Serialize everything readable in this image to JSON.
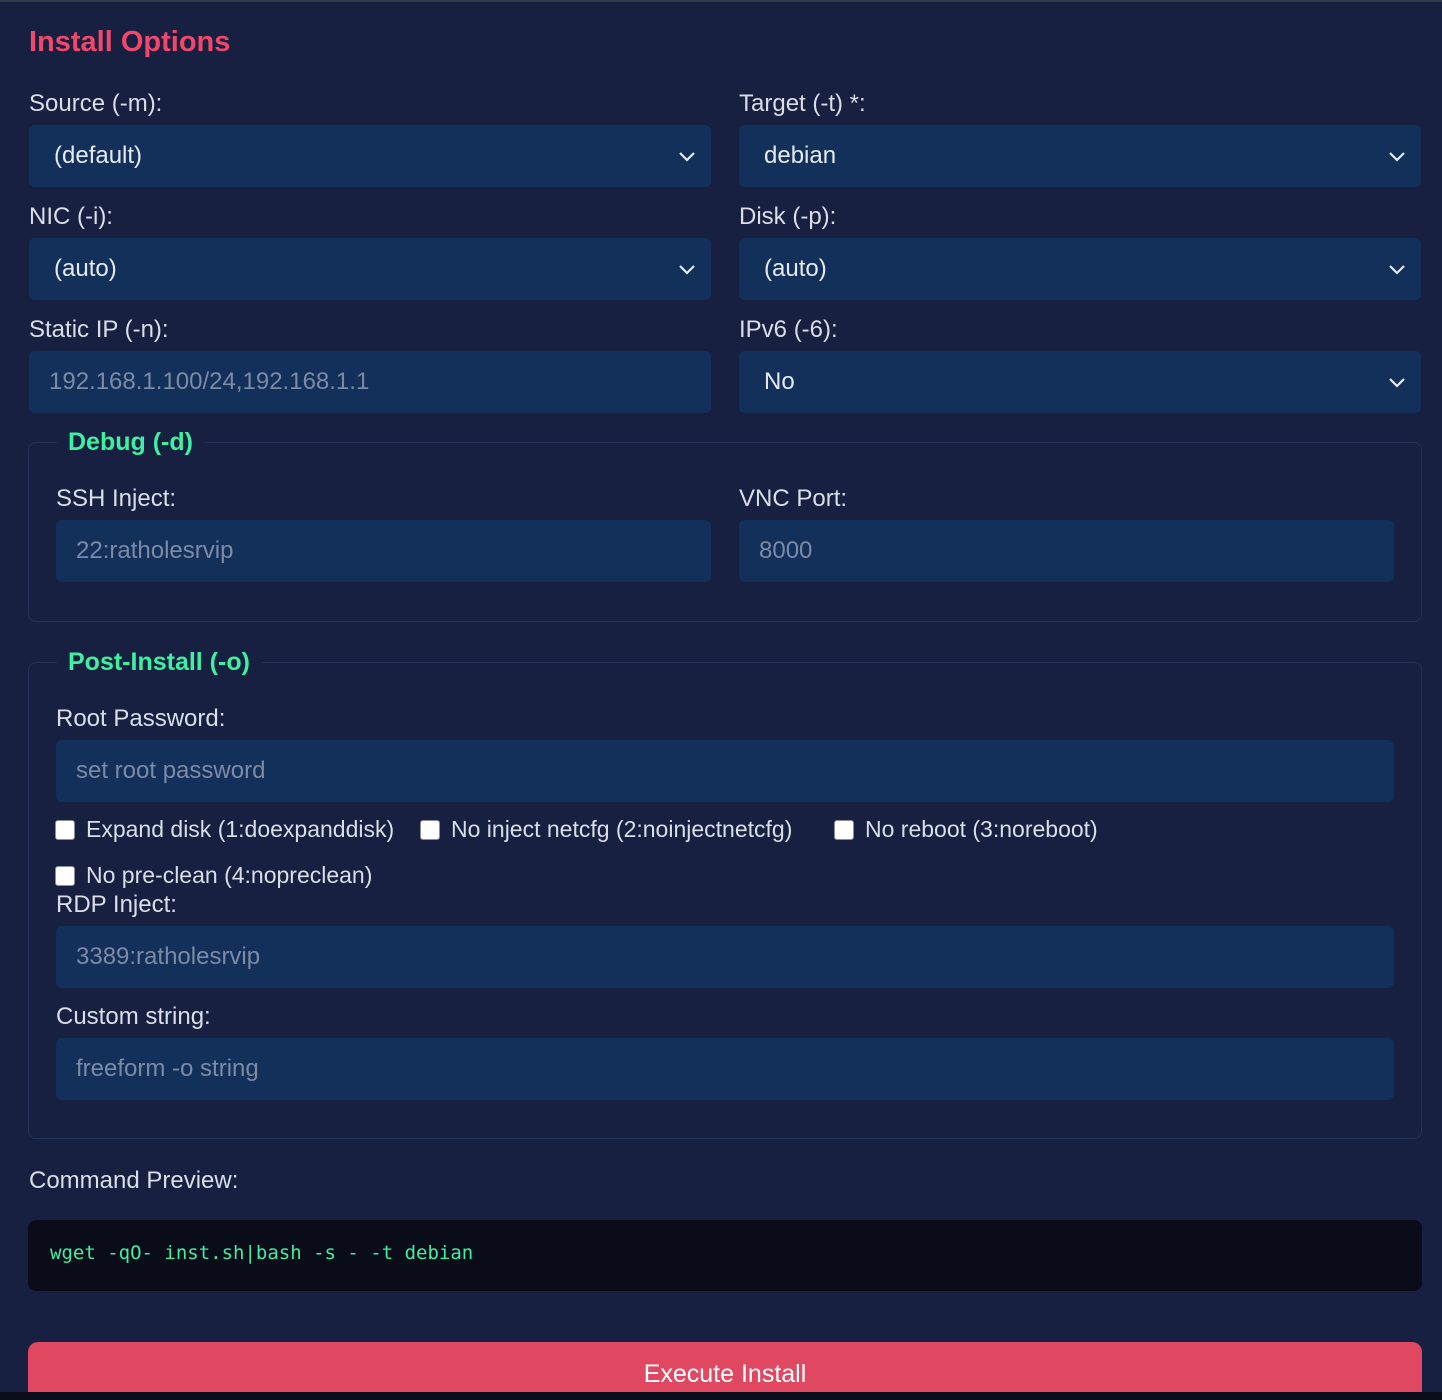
{
  "page": {
    "title": "Install Options"
  },
  "options": {
    "source_label": "Source (-m):",
    "source_value": "(default)",
    "target_label": "Target (-t) *:",
    "target_value": "debian",
    "nic_label": "NIC (-i):",
    "nic_value": "(auto)",
    "disk_label": "Disk (-p):",
    "disk_value": "(auto)",
    "static_ip_label": "Static IP (-n):",
    "static_ip_placeholder": "192.168.1.100/24,192.168.1.1",
    "ipv6_label": "IPv6 (-6):",
    "ipv6_value": "No"
  },
  "debug": {
    "legend": "Debug (-d)",
    "ssh_label": "SSH Inject:",
    "ssh_placeholder": "22:ratholesrvip",
    "vnc_label": "VNC Port:",
    "vnc_placeholder": "8000"
  },
  "post_install": {
    "legend": "Post-Install (-o)",
    "root_password_label": "Root Password:",
    "root_password_placeholder": "set root password",
    "checkboxes": [
      {
        "label": "Expand disk (1:doexpanddisk)",
        "checked": false
      },
      {
        "label": "No inject netcfg (2:noinjectnetcfg)",
        "checked": false
      },
      {
        "label": "No reboot (3:noreboot)",
        "checked": false
      },
      {
        "label": "No pre-clean (4:nopreclean)",
        "checked": false
      }
    ],
    "rdp_label": "RDP Inject:",
    "rdp_placeholder": "3389:ratholesrvip",
    "custom_label": "Custom string:",
    "custom_placeholder": "freeform -o string"
  },
  "preview": {
    "label": "Command Preview:",
    "command": "wget -qO- inst.sh|bash -s - -t debian"
  },
  "actions": {
    "execute_label": "Execute Install"
  },
  "colors": {
    "title": "#f0476a",
    "legend": "#3ef0a0",
    "field_bg": "#12305a",
    "panel_bg": "#172040",
    "button": "#e04862"
  }
}
